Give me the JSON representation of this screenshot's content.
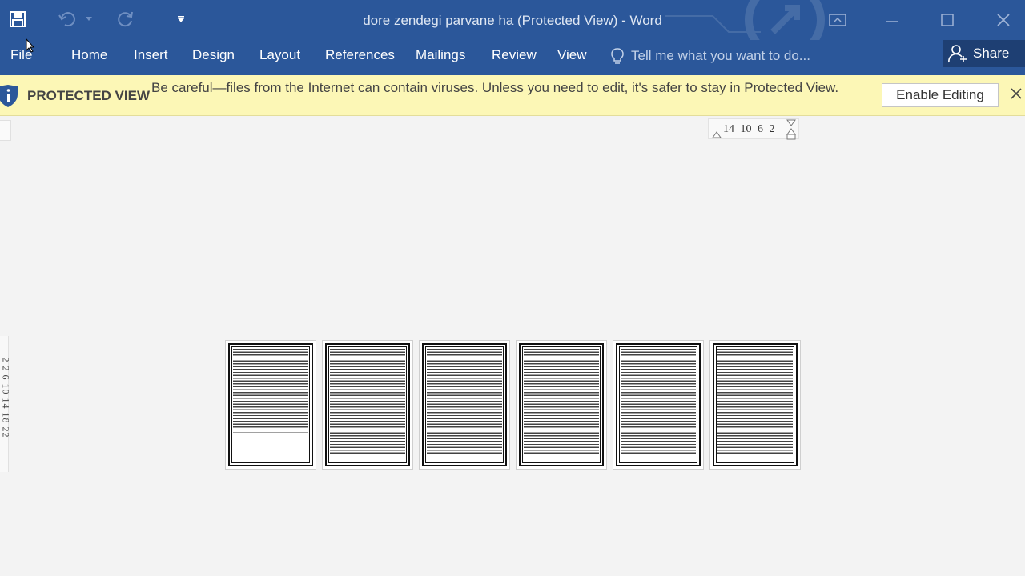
{
  "window": {
    "title": "dore zendegi parvane ha (Protected View) - Word"
  },
  "quick_access": {
    "icons": [
      "save-icon",
      "undo-icon",
      "undo-dropdown-icon",
      "redo-icon",
      "customize-qat-icon"
    ]
  },
  "menu": {
    "file": "File",
    "tabs": [
      "Home",
      "Insert",
      "Design",
      "Layout",
      "References",
      "Mailings",
      "Review",
      "View"
    ],
    "tell_me": "Tell me what you want to do...",
    "share": "Share"
  },
  "protected_view": {
    "label": "PROTECTED VIEW",
    "message": "Be careful—files from the Internet can contain viruses. Unless you need to edit, it's safer to stay in Protected View.",
    "enable_button": "Enable Editing"
  },
  "rulers": {
    "horizontal": "14 10 6 2",
    "vertical": "2 2 6 10 14 18 22"
  },
  "pages": [
    {
      "fill": 0.75
    },
    {
      "fill": 0.95
    },
    {
      "fill": 0.95
    },
    {
      "fill": 0.95
    },
    {
      "fill": 0.95
    },
    {
      "fill": 0.95
    }
  ]
}
